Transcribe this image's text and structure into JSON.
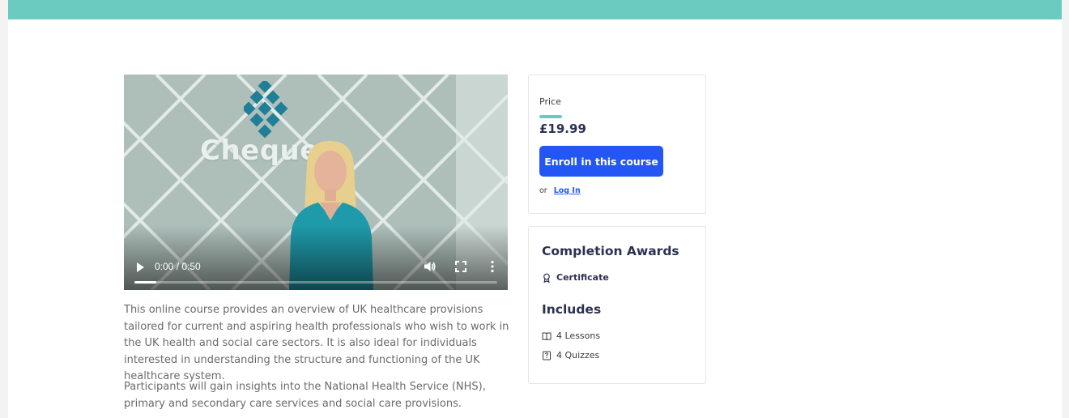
{
  "video": {
    "brand_text": "Chequer",
    "time_display": "0:00 / 0:50",
    "progress_fraction": 0.06
  },
  "description": {
    "paragraph_1": "This online course provides an overview of UK healthcare provisions tailored for current and aspiring health professionals who wish to work in the UK health and social care sectors. It is also ideal for individuals interested in understanding the structure and functioning of the UK healthcare system.",
    "paragraph_2": "Participants will gain insights into the National Health Service (NHS), primary and secondary care services and social care provisions."
  },
  "price_card": {
    "label": "Price",
    "value": "£19.99",
    "enroll_label": "Enroll in this course",
    "or_text": "or",
    "login_label": "Log In"
  },
  "awards_card": {
    "awards_heading": "Completion Awards",
    "certificate_label": "Certificate",
    "includes_heading": "Includes",
    "lessons_label": "4 Lessons",
    "quizzes_label": "4 Quizzes"
  },
  "colors": {
    "topbar": "#6ccbc1",
    "accent": "#6ccbc1",
    "button": "#2456f5",
    "heading": "#2c3152"
  },
  "icons": {
    "certificate": "award-icon",
    "lessons": "book-icon",
    "quizzes": "quiz-icon",
    "play": "play-icon",
    "volume": "volume-icon",
    "fullscreen": "fullscreen-icon",
    "more": "more-vertical-icon"
  }
}
